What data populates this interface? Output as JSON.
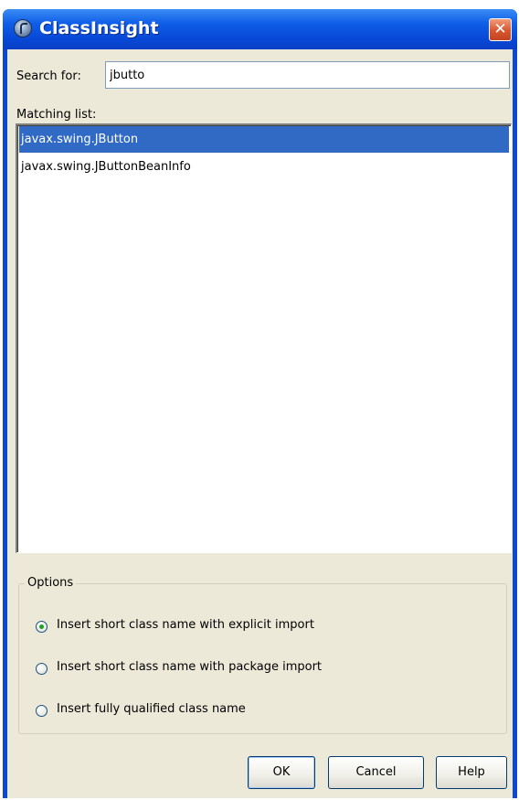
{
  "window": {
    "title": "ClassInsight",
    "close_glyph": "✕"
  },
  "search": {
    "label": "Search for:",
    "value": "jbutto"
  },
  "matching": {
    "label": "Matching list:",
    "items": [
      {
        "label": "javax.swing.JButton",
        "selected": true
      },
      {
        "label": "javax.swing.JButtonBeanInfo",
        "selected": false
      }
    ]
  },
  "options": {
    "legend": "Options",
    "radios": [
      {
        "label": "Insert short class name with explicit import",
        "checked": true
      },
      {
        "label": "Insert short class name with package import",
        "checked": false
      },
      {
        "label": "Insert fully qualified class name",
        "checked": false
      }
    ]
  },
  "buttons": {
    "ok": "OK",
    "cancel": "Cancel",
    "help": "Help"
  },
  "icons": {
    "app": "app-icon",
    "close": "close-icon"
  },
  "colors": {
    "titlebar": "#0a48d8",
    "selection": "#316ac5",
    "dialog_bg": "#ece9d8"
  }
}
